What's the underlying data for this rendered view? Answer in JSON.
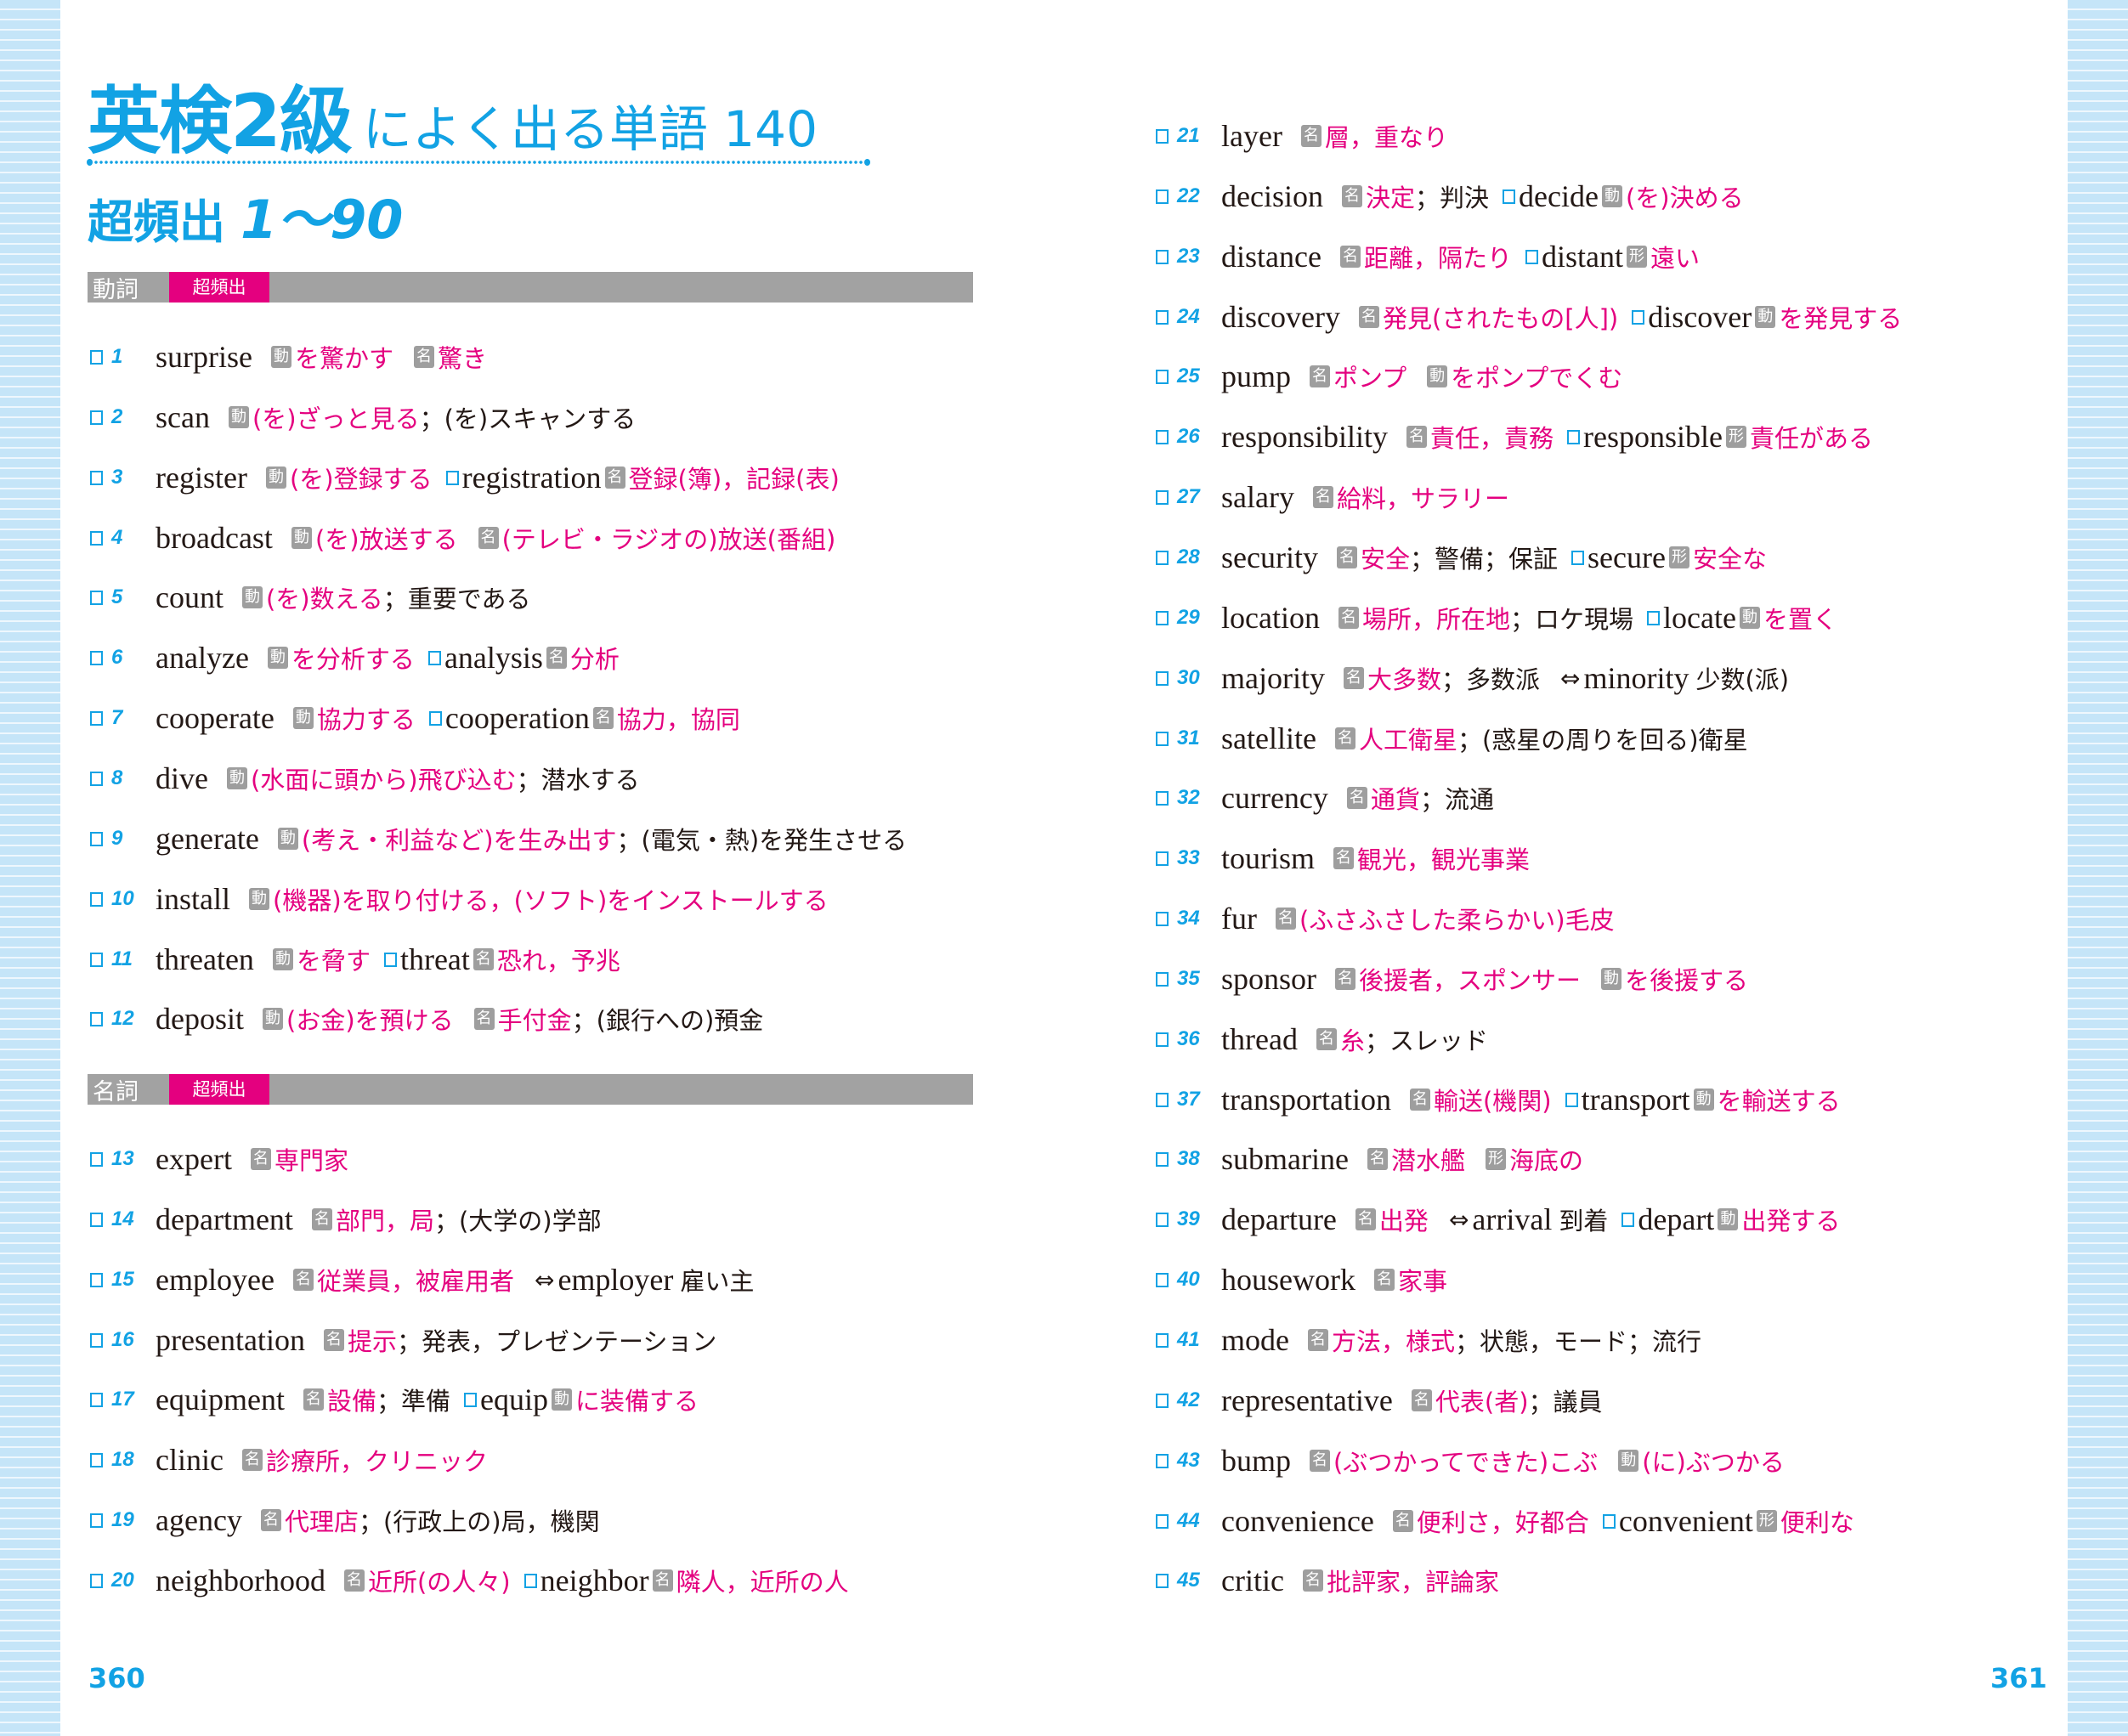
{
  "title": {
    "main": "英検2級",
    "rest": "によく出る単語 140"
  },
  "subtitle": {
    "label": "超頻出",
    "range": "1〜90"
  },
  "colors": {
    "accent_blue": "#12a2e4",
    "meaning_magenta": "#e4007f",
    "badge_gray": "#9e9e9e",
    "section_gray": "#a2a2a2"
  },
  "sections": [
    {
      "pos": "動詞",
      "freq": "超頻出"
    },
    {
      "pos": "名詞",
      "freq": "超頻出"
    }
  ],
  "page_numbers": {
    "left": "360",
    "right": "361"
  },
  "left_entries": [
    {
      "num": "1",
      "word": "surprise",
      "parts": [
        {
          "t": "badge",
          "v": "動"
        },
        {
          "t": "mean",
          "v": "を驚かす"
        },
        {
          "t": "gap"
        },
        {
          "t": "badge",
          "v": "名"
        },
        {
          "t": "mean",
          "v": "驚き"
        }
      ]
    },
    {
      "num": "2",
      "word": "scan",
      "parts": [
        {
          "t": "badge",
          "v": "動"
        },
        {
          "t": "mean",
          "v": "(を)ざっと見る"
        },
        {
          "t": "plain",
          "v": "；(を)スキャンする"
        }
      ]
    },
    {
      "num": "3",
      "word": "register",
      "parts": [
        {
          "t": "badge",
          "v": "動"
        },
        {
          "t": "mean",
          "v": "(を)登録する"
        },
        {
          "t": "chk"
        },
        {
          "t": "subword",
          "v": "registration"
        },
        {
          "t": "badge",
          "v": "名"
        },
        {
          "t": "mean",
          "v": "登録(簿)，記録(表)"
        }
      ]
    },
    {
      "num": "4",
      "word": "broadcast",
      "parts": [
        {
          "t": "badge",
          "v": "動"
        },
        {
          "t": "mean",
          "v": "(を)放送する"
        },
        {
          "t": "gap"
        },
        {
          "t": "badge",
          "v": "名"
        },
        {
          "t": "mean",
          "v": "(テレビ・ラジオの)放送(番組)"
        }
      ]
    },
    {
      "num": "5",
      "word": "count",
      "parts": [
        {
          "t": "badge",
          "v": "動"
        },
        {
          "t": "mean",
          "v": "(を)数える"
        },
        {
          "t": "plain",
          "v": "；重要である"
        }
      ]
    },
    {
      "num": "6",
      "word": "analyze",
      "parts": [
        {
          "t": "badge",
          "v": "動"
        },
        {
          "t": "mean",
          "v": "を分析する"
        },
        {
          "t": "chk"
        },
        {
          "t": "subword",
          "v": "analysis"
        },
        {
          "t": "badge",
          "v": "名"
        },
        {
          "t": "mean",
          "v": "分析"
        }
      ]
    },
    {
      "num": "7",
      "word": "cooperate",
      "parts": [
        {
          "t": "badge",
          "v": "動"
        },
        {
          "t": "mean",
          "v": "協力する"
        },
        {
          "t": "chk"
        },
        {
          "t": "subword",
          "v": "cooperation"
        },
        {
          "t": "badge",
          "v": "名"
        },
        {
          "t": "mean",
          "v": "協力，協同"
        }
      ]
    },
    {
      "num": "8",
      "word": "dive",
      "parts": [
        {
          "t": "badge",
          "v": "動"
        },
        {
          "t": "mean",
          "v": "(水面に頭から)飛び込む"
        },
        {
          "t": "plain",
          "v": "；潜水する"
        }
      ]
    },
    {
      "num": "9",
      "word": "generate",
      "parts": [
        {
          "t": "badge",
          "v": "動"
        },
        {
          "t": "mean",
          "v": "(考え・利益など)を生み出す"
        },
        {
          "t": "plain",
          "v": "；(電気・熱)を発生させる"
        }
      ]
    },
    {
      "num": "10",
      "word": "install",
      "parts": [
        {
          "t": "badge",
          "v": "動"
        },
        {
          "t": "mean",
          "v": "(機器)を取り付ける，(ソフト)をインストールする"
        }
      ]
    },
    {
      "num": "11",
      "word": "threaten",
      "parts": [
        {
          "t": "badge",
          "v": "動"
        },
        {
          "t": "mean",
          "v": "を脅す"
        },
        {
          "t": "chk"
        },
        {
          "t": "subword",
          "v": "threat"
        },
        {
          "t": "badge",
          "v": "名"
        },
        {
          "t": "mean",
          "v": "恐れ，予兆"
        }
      ]
    },
    {
      "num": "12",
      "word": "deposit",
      "parts": [
        {
          "t": "badge",
          "v": "動"
        },
        {
          "t": "mean",
          "v": "(お金)を預ける"
        },
        {
          "t": "gap"
        },
        {
          "t": "badge",
          "v": "名"
        },
        {
          "t": "mean",
          "v": "手付金"
        },
        {
          "t": "plain",
          "v": "；(銀行への)預金"
        }
      ]
    },
    {
      "num": "13",
      "word": "expert",
      "parts": [
        {
          "t": "badge",
          "v": "名"
        },
        {
          "t": "mean",
          "v": "専門家"
        }
      ]
    },
    {
      "num": "14",
      "word": "department",
      "parts": [
        {
          "t": "badge",
          "v": "名"
        },
        {
          "t": "mean",
          "v": "部門，局"
        },
        {
          "t": "plain",
          "v": "；(大学の)学部"
        }
      ]
    },
    {
      "num": "15",
      "word": "employee",
      "parts": [
        {
          "t": "badge",
          "v": "名"
        },
        {
          "t": "mean",
          "v": "従業員，被雇用者"
        },
        {
          "t": "arrow",
          "v": "⇔"
        },
        {
          "t": "anto",
          "v": "employer"
        },
        {
          "t": "plain",
          "v": "雇い主"
        }
      ]
    },
    {
      "num": "16",
      "word": "presentation",
      "parts": [
        {
          "t": "badge",
          "v": "名"
        },
        {
          "t": "mean",
          "v": "提示"
        },
        {
          "t": "plain",
          "v": "；発表，プレゼンテーション"
        }
      ]
    },
    {
      "num": "17",
      "word": "equipment",
      "parts": [
        {
          "t": "badge",
          "v": "名"
        },
        {
          "t": "mean",
          "v": "設備"
        },
        {
          "t": "plain",
          "v": "；準備"
        },
        {
          "t": "chk"
        },
        {
          "t": "subword",
          "v": "equip"
        },
        {
          "t": "badge",
          "v": "動"
        },
        {
          "t": "mean",
          "v": "に装備する"
        }
      ]
    },
    {
      "num": "18",
      "word": "clinic",
      "parts": [
        {
          "t": "badge",
          "v": "名"
        },
        {
          "t": "mean",
          "v": "診療所，クリニック"
        }
      ]
    },
    {
      "num": "19",
      "word": "agency",
      "parts": [
        {
          "t": "badge",
          "v": "名"
        },
        {
          "t": "mean",
          "v": "代理店"
        },
        {
          "t": "plain",
          "v": "；(行政上の)局，機関"
        }
      ]
    },
    {
      "num": "20",
      "word": "neighborhood",
      "parts": [
        {
          "t": "badge",
          "v": "名"
        },
        {
          "t": "mean",
          "v": "近所(の人々)"
        },
        {
          "t": "chk"
        },
        {
          "t": "subword",
          "v": "neighbor"
        },
        {
          "t": "badge",
          "v": "名"
        },
        {
          "t": "mean",
          "v": "隣人，近所の人"
        }
      ]
    }
  ],
  "right_entries": [
    {
      "num": "21",
      "word": "layer",
      "parts": [
        {
          "t": "badge",
          "v": "名"
        },
        {
          "t": "mean",
          "v": "層，重なり"
        }
      ]
    },
    {
      "num": "22",
      "word": "decision",
      "parts": [
        {
          "t": "badge",
          "v": "名"
        },
        {
          "t": "mean",
          "v": "決定"
        },
        {
          "t": "plain",
          "v": "；判決"
        },
        {
          "t": "chk"
        },
        {
          "t": "subword",
          "v": "decide"
        },
        {
          "t": "badge",
          "v": "動"
        },
        {
          "t": "mean",
          "v": "(を)決める"
        }
      ]
    },
    {
      "num": "23",
      "word": "distance",
      "parts": [
        {
          "t": "badge",
          "v": "名"
        },
        {
          "t": "mean",
          "v": "距離，隔たり"
        },
        {
          "t": "chk"
        },
        {
          "t": "subword",
          "v": "distant"
        },
        {
          "t": "badge",
          "v": "形"
        },
        {
          "t": "mean",
          "v": "遠い"
        }
      ]
    },
    {
      "num": "24",
      "word": "discovery",
      "parts": [
        {
          "t": "badge",
          "v": "名"
        },
        {
          "t": "mean",
          "v": "発見(されたもの[人])"
        },
        {
          "t": "chk"
        },
        {
          "t": "subword",
          "v": "discover"
        },
        {
          "t": "badge",
          "v": "動"
        },
        {
          "t": "mean",
          "v": "を発見する"
        }
      ]
    },
    {
      "num": "25",
      "word": "pump",
      "parts": [
        {
          "t": "badge",
          "v": "名"
        },
        {
          "t": "mean",
          "v": "ポンプ"
        },
        {
          "t": "gap"
        },
        {
          "t": "badge",
          "v": "動"
        },
        {
          "t": "mean",
          "v": "をポンプでくむ"
        }
      ]
    },
    {
      "num": "26",
      "word": "responsibility",
      "parts": [
        {
          "t": "badge",
          "v": "名"
        },
        {
          "t": "mean",
          "v": "責任，責務"
        },
        {
          "t": "chk"
        },
        {
          "t": "subword",
          "v": "responsible"
        },
        {
          "t": "badge",
          "v": "形"
        },
        {
          "t": "mean",
          "v": "責任がある"
        }
      ]
    },
    {
      "num": "27",
      "word": "salary",
      "parts": [
        {
          "t": "badge",
          "v": "名"
        },
        {
          "t": "mean",
          "v": "給料，サラリー"
        }
      ]
    },
    {
      "num": "28",
      "word": "security",
      "parts": [
        {
          "t": "badge",
          "v": "名"
        },
        {
          "t": "mean",
          "v": "安全"
        },
        {
          "t": "plain",
          "v": "；警備；保証"
        },
        {
          "t": "chk"
        },
        {
          "t": "subword",
          "v": "secure"
        },
        {
          "t": "badge",
          "v": "形"
        },
        {
          "t": "mean",
          "v": "安全な"
        }
      ]
    },
    {
      "num": "29",
      "word": "location",
      "parts": [
        {
          "t": "badge",
          "v": "名"
        },
        {
          "t": "mean",
          "v": "場所，所在地"
        },
        {
          "t": "plain",
          "v": "；ロケ現場"
        },
        {
          "t": "chk"
        },
        {
          "t": "subword",
          "v": "locate"
        },
        {
          "t": "badge",
          "v": "動"
        },
        {
          "t": "mean",
          "v": "を置く"
        }
      ]
    },
    {
      "num": "30",
      "word": "majority",
      "parts": [
        {
          "t": "badge",
          "v": "名"
        },
        {
          "t": "mean",
          "v": "大多数"
        },
        {
          "t": "plain",
          "v": "；多数派"
        },
        {
          "t": "arrow",
          "v": "⇔"
        },
        {
          "t": "anto",
          "v": "minority"
        },
        {
          "t": "plain",
          "v": "少数(派)"
        }
      ]
    },
    {
      "num": "31",
      "word": "satellite",
      "parts": [
        {
          "t": "badge",
          "v": "名"
        },
        {
          "t": "mean",
          "v": "人工衛星"
        },
        {
          "t": "plain",
          "v": "；(惑星の周りを回る)衛星"
        }
      ]
    },
    {
      "num": "32",
      "word": "currency",
      "parts": [
        {
          "t": "badge",
          "v": "名"
        },
        {
          "t": "mean",
          "v": "通貨"
        },
        {
          "t": "plain",
          "v": "；流通"
        }
      ]
    },
    {
      "num": "33",
      "word": "tourism",
      "parts": [
        {
          "t": "badge",
          "v": "名"
        },
        {
          "t": "mean",
          "v": "観光，観光事業"
        }
      ]
    },
    {
      "num": "34",
      "word": "fur",
      "parts": [
        {
          "t": "badge",
          "v": "名"
        },
        {
          "t": "mean",
          "v": "(ふさふさした柔らかい)毛皮"
        }
      ]
    },
    {
      "num": "35",
      "word": "sponsor",
      "parts": [
        {
          "t": "badge",
          "v": "名"
        },
        {
          "t": "mean",
          "v": "後援者，スポンサー"
        },
        {
          "t": "gap"
        },
        {
          "t": "badge",
          "v": "動"
        },
        {
          "t": "mean",
          "v": "を後援する"
        }
      ]
    },
    {
      "num": "36",
      "word": "thread",
      "parts": [
        {
          "t": "badge",
          "v": "名"
        },
        {
          "t": "mean",
          "v": "糸"
        },
        {
          "t": "plain",
          "v": "；スレッド"
        }
      ]
    },
    {
      "num": "37",
      "word": "transportation",
      "parts": [
        {
          "t": "badge",
          "v": "名"
        },
        {
          "t": "mean",
          "v": "輸送(機関)"
        },
        {
          "t": "chk"
        },
        {
          "t": "subword",
          "v": "transport"
        },
        {
          "t": "badge",
          "v": "動"
        },
        {
          "t": "mean",
          "v": "を輸送する"
        }
      ]
    },
    {
      "num": "38",
      "word": "submarine",
      "parts": [
        {
          "t": "badge",
          "v": "名"
        },
        {
          "t": "mean",
          "v": "潜水艦"
        },
        {
          "t": "gap"
        },
        {
          "t": "badge",
          "v": "形"
        },
        {
          "t": "mean",
          "v": "海底の"
        }
      ]
    },
    {
      "num": "39",
      "word": "departure",
      "parts": [
        {
          "t": "badge",
          "v": "名"
        },
        {
          "t": "mean",
          "v": "出発"
        },
        {
          "t": "arrow",
          "v": "⇔"
        },
        {
          "t": "anto",
          "v": "arrival"
        },
        {
          "t": "plain",
          "v": "到着"
        },
        {
          "t": "chk"
        },
        {
          "t": "subword",
          "v": "depart"
        },
        {
          "t": "badge",
          "v": "動"
        },
        {
          "t": "mean",
          "v": "出発する"
        }
      ]
    },
    {
      "num": "40",
      "word": "housework",
      "parts": [
        {
          "t": "badge",
          "v": "名"
        },
        {
          "t": "mean",
          "v": "家事"
        }
      ]
    },
    {
      "num": "41",
      "word": "mode",
      "parts": [
        {
          "t": "badge",
          "v": "名"
        },
        {
          "t": "mean",
          "v": "方法，様式"
        },
        {
          "t": "plain",
          "v": "；状態，モード；流行"
        }
      ]
    },
    {
      "num": "42",
      "word": "representative",
      "parts": [
        {
          "t": "badge",
          "v": "名"
        },
        {
          "t": "mean",
          "v": "代表(者)"
        },
        {
          "t": "plain",
          "v": "；議員"
        }
      ]
    },
    {
      "num": "43",
      "word": "bump",
      "parts": [
        {
          "t": "badge",
          "v": "名"
        },
        {
          "t": "mean",
          "v": "(ぶつかってできた)こぶ"
        },
        {
          "t": "gap"
        },
        {
          "t": "badge",
          "v": "動"
        },
        {
          "t": "mean",
          "v": "(に)ぶつかる"
        }
      ]
    },
    {
      "num": "44",
      "word": "convenience",
      "parts": [
        {
          "t": "badge",
          "v": "名"
        },
        {
          "t": "mean",
          "v": "便利さ，好都合"
        },
        {
          "t": "chk"
        },
        {
          "t": "subword",
          "v": "convenient"
        },
        {
          "t": "badge",
          "v": "形"
        },
        {
          "t": "mean",
          "v": "便利な"
        }
      ]
    },
    {
      "num": "45",
      "word": "critic",
      "parts": [
        {
          "t": "badge",
          "v": "名"
        },
        {
          "t": "mean",
          "v": "批評家，評論家"
        }
      ]
    }
  ]
}
